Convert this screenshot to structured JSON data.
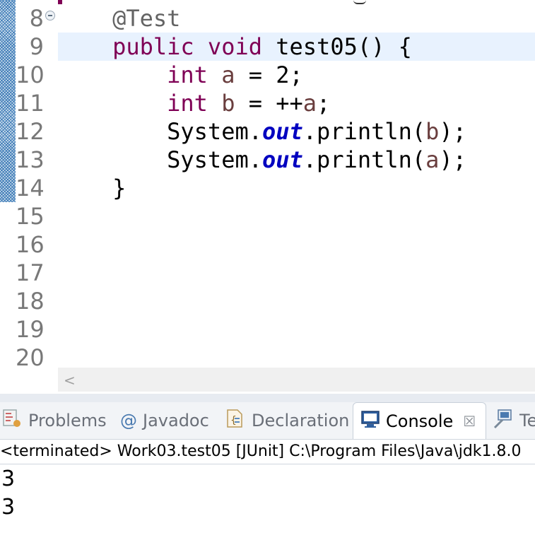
{
  "editor": {
    "line_numbers": [
      "8",
      "9",
      "10",
      "11",
      "12",
      "13",
      "14",
      "15",
      "16",
      "17",
      "18",
      "19",
      "20"
    ],
    "code": {
      "l8_annotation": "@Test",
      "l9_public": "public",
      "l9_void": "void",
      "l9_rest": " test05() {",
      "l10_int": "int",
      "l10_var": "a",
      "l10_rest": " = 2;",
      "l11_int": "int",
      "l11_var": "b",
      "l11_mid": " = ++",
      "l11_var2": "a",
      "l11_end": ";",
      "l12_system": "System.",
      "l12_out": "out",
      "l12_mid": ".println(",
      "l12_arg": "b",
      "l12_end": ");",
      "l13_system": "System.",
      "l13_out": "out",
      "l13_mid": ".println(",
      "l13_arg": "a",
      "l13_end": ");",
      "l14_brace": "}"
    },
    "current_line": "9",
    "scroll_left_glyph": "<"
  },
  "panel": {
    "tabs": [
      {
        "label": "Problems",
        "icon": "problems-icon"
      },
      {
        "label": "Javadoc",
        "icon": "javadoc-icon",
        "glyph": "@"
      },
      {
        "label": "Declaration",
        "icon": "declaration-icon"
      },
      {
        "label": "Console",
        "icon": "console-icon",
        "active": true,
        "close": "☒"
      },
      {
        "label": "Te",
        "icon": "terminal-icon"
      }
    ],
    "console_header": "<terminated> Work03.test05 [JUnit] C:\\Program Files\\Java\\jdk1.8.0",
    "output": [
      "3",
      "3"
    ]
  },
  "colors": {
    "keyword": "#7f0055",
    "annotation": "#646464",
    "local_variable": "#6a3e3e",
    "static_field": "#0000c0",
    "current_line_bg": "#e8f2fe"
  }
}
